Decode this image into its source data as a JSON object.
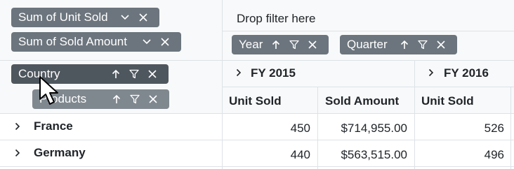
{
  "value_chips": [
    {
      "label": "Sum of Unit Sold"
    },
    {
      "label": "Sum of Sold Amount"
    }
  ],
  "filter_area": {
    "placeholder": "Drop filter here"
  },
  "column_chips": [
    {
      "label": "Year"
    },
    {
      "label": "Quarter"
    }
  ],
  "row_chips": [
    {
      "label": "Country",
      "state": "dragging"
    },
    {
      "label": "Products",
      "state": "ghost"
    }
  ],
  "column_groups": [
    {
      "label": "FY 2015"
    },
    {
      "label": "FY 2016"
    }
  ],
  "column_headers": [
    "Unit Sold",
    "Sold Amount",
    "Unit Sold"
  ],
  "rows": [
    {
      "label": "France",
      "values": [
        "450",
        "$714,955.00",
        "526"
      ]
    },
    {
      "label": "Germany",
      "values": [
        "440",
        "$563,515.00",
        "496"
      ]
    }
  ],
  "colors": {
    "chip_bg": "#6c757d",
    "chip_dragging_bg": "#4f575e",
    "border": "#dee2e6",
    "header_bg": "#f8f9fa"
  },
  "icons": {
    "sort": "arrow-up-icon",
    "filter": "funnel-icon",
    "remove": "close-icon",
    "menu": "chevron-down-icon",
    "expand": "chevron-right-icon",
    "cursor": "mouse-pointer-icon"
  }
}
